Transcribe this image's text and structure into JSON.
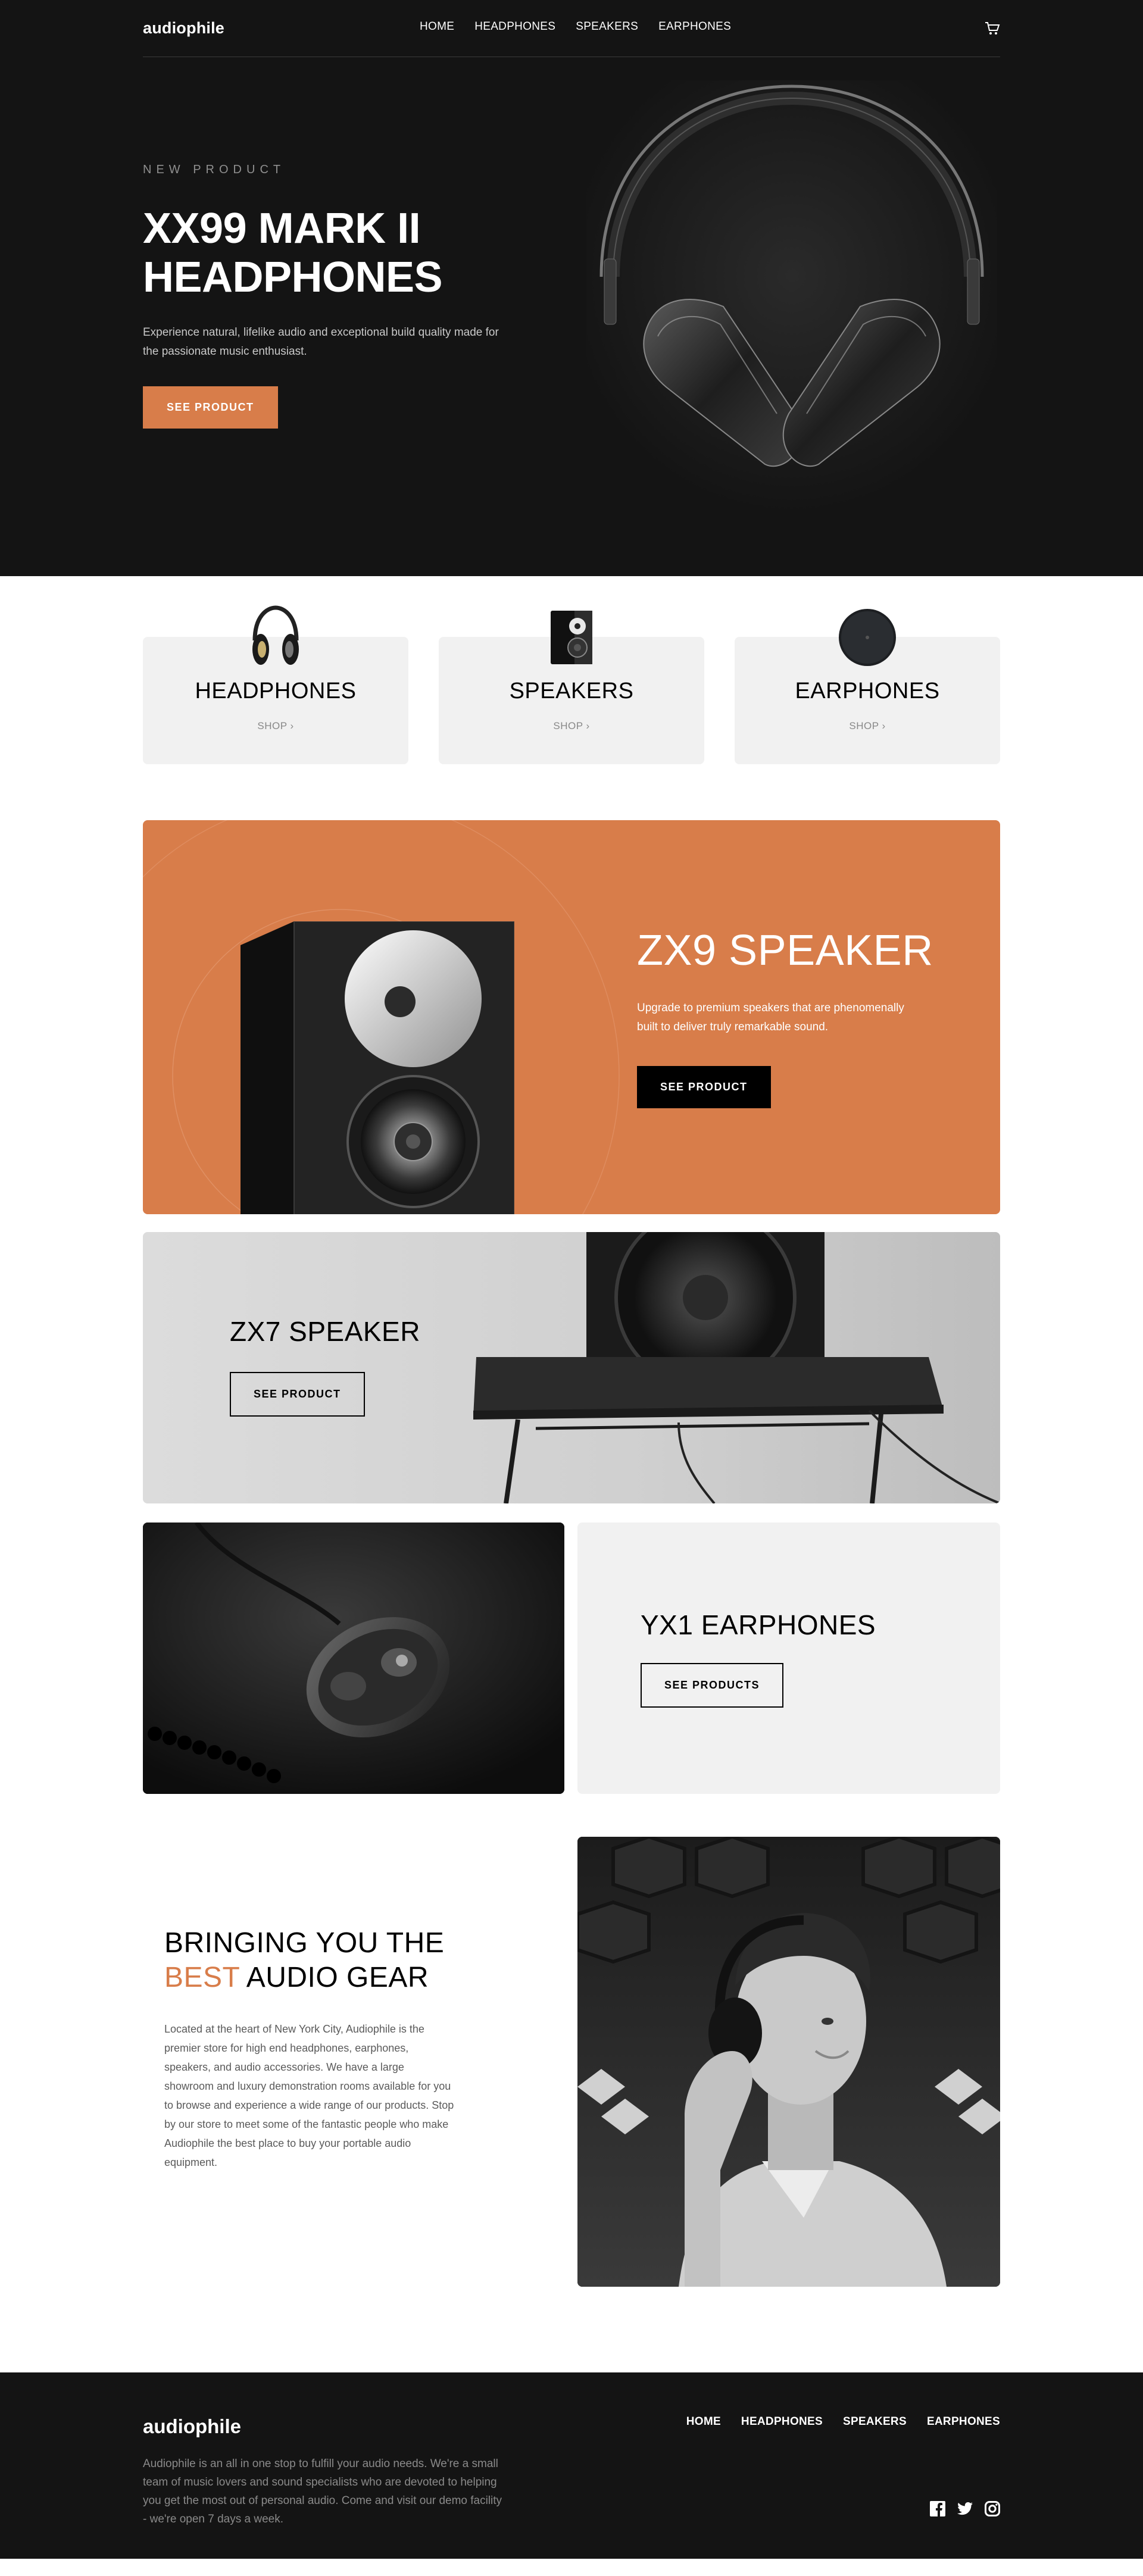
{
  "header": {
    "logo": "audiophile",
    "nav": [
      "HOME",
      "HEADPHONES",
      "SPEAKERS",
      "EARPHONES"
    ],
    "cart_icon": "cart-icon"
  },
  "hero": {
    "overline": "NEW PRODUCT",
    "title_line1": "XX99 MARK II",
    "title_line2": "HEADPHONES",
    "text": "Experience natural, lifelike audio and exceptional build quality made for the passionate music enthusiast.",
    "cta": "SEE PRODUCT"
  },
  "categories": [
    {
      "name": "HEADPHONES",
      "shop": "SHOP ›"
    },
    {
      "name": "SPEAKERS",
      "shop": "SHOP ›"
    },
    {
      "name": "EARPHONES",
      "shop": "SHOP ›"
    }
  ],
  "zx9": {
    "title": "ZX9 SPEAKER",
    "text": "Upgrade to premium speakers that are phenomenally built to deliver truly remarkable sound.",
    "cta": "SEE PRODUCT"
  },
  "zx7": {
    "title": "ZX7 SPEAKER",
    "cta": "SEE PRODUCT"
  },
  "yx1": {
    "title": "YX1 EARPHONES",
    "cta": "SEE PRODUCTS"
  },
  "about": {
    "title_part1": "BRINGING YOU THE",
    "title_accent": "BEST",
    "title_part2": "AUDIO GEAR",
    "text": "Located at the heart of New York City, Audiophile is the premier store for high end headphones, earphones, speakers, and audio accessories. We have a large showroom and luxury demonstration rooms available for you to browse and experience a wide range of our products. Stop by our store to meet some of the fantastic people who make Audiophile the best place to buy your portable audio equipment."
  },
  "footer": {
    "logo": "audiophile",
    "nav": [
      "HOME",
      "HEADPHONES",
      "SPEAKERS",
      "EARPHONES"
    ],
    "text": "Audiophile is an all in one stop to fulfill your audio needs. We're a small team of music lovers and sound specialists who are devoted to helping you get the most out of personal audio. Come and visit our demo facility - we're open 7 days a week.",
    "social_icons": [
      "facebook-icon",
      "twitter-icon",
      "instagram-icon"
    ]
  },
  "colors": {
    "accent": "#d87d4a",
    "dark": "#141414",
    "light_gray": "#f1f1f1"
  }
}
